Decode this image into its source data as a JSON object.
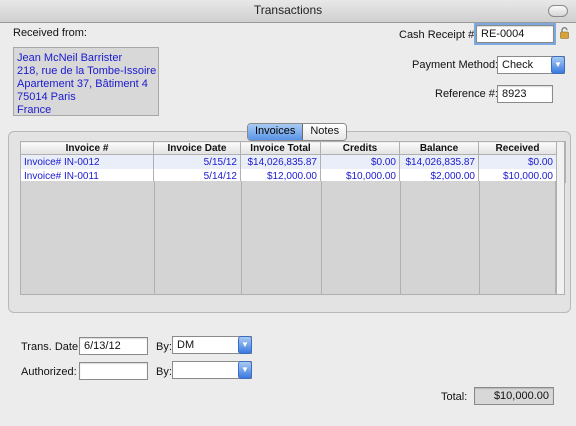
{
  "window": {
    "title": "Transactions"
  },
  "received_from": {
    "label": "Received from:",
    "lines": [
      "Jean McNeil Barrister",
      "218, rue de la Tombe-Issoire",
      "Apartement 37, Bâtiment 4",
      "75014 Paris",
      "France"
    ]
  },
  "cash_receipt": {
    "label": "Cash Receipt #",
    "value": "RE-0004"
  },
  "payment_method": {
    "label": "Payment Method:",
    "value": "Check"
  },
  "reference": {
    "label": "Reference #:",
    "value": "8923"
  },
  "tabs": [
    {
      "label": "Invoices"
    },
    {
      "label": "Notes"
    }
  ],
  "table": {
    "headers": [
      "Invoice #",
      "Invoice Date",
      "Invoice Total",
      "Credits",
      "Balance",
      "Received"
    ],
    "rows": [
      [
        "Invoice# IN-0012",
        "5/15/12",
        "$14,026,835.87",
        "$0.00",
        "$14,026,835.87",
        "$0.00"
      ],
      [
        "Invoice# IN-0011",
        "5/14/12",
        "$12,000.00",
        "$10,000.00",
        "$2,000.00",
        "$10,000.00"
      ]
    ]
  },
  "trans_date": {
    "label": "Trans. Date:",
    "value": "6/13/12",
    "by_label": "By:",
    "by_value": "DM"
  },
  "authorized": {
    "label": "Authorized:",
    "value": "",
    "by_label": "By:",
    "by_value": ""
  },
  "total": {
    "label": "Total:",
    "value": "$10,000.00"
  }
}
